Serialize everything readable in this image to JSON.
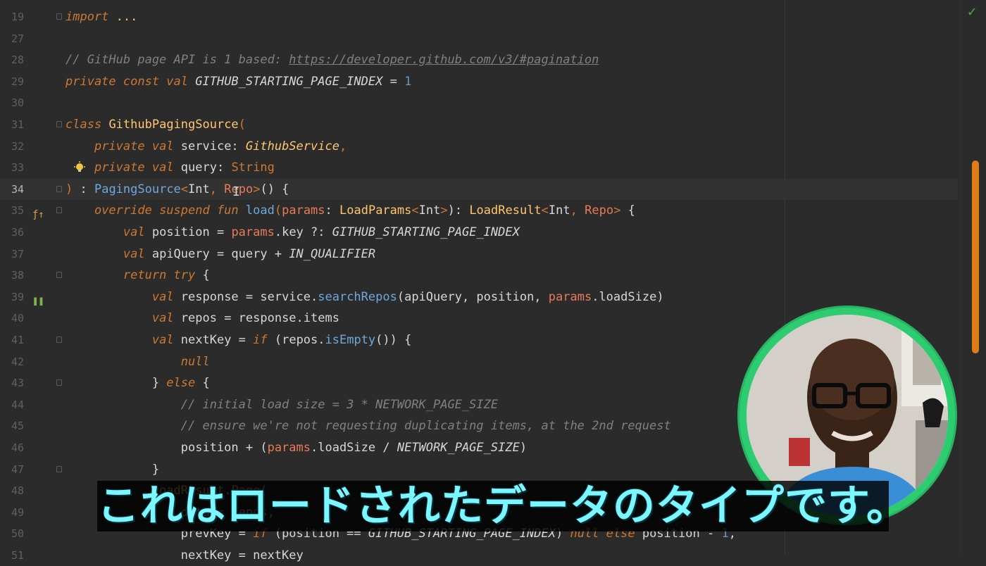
{
  "editor": {
    "lines": [
      {
        "n": "19",
        "segs": [
          {
            "c": "kw",
            "t": "import"
          },
          {
            "c": "plain",
            "t": " "
          },
          {
            "c": "cls",
            "t": "..."
          }
        ],
        "fold": true
      },
      {
        "n": "27",
        "segs": []
      },
      {
        "n": "28",
        "segs": [
          {
            "c": "cmt",
            "t": "// GitHub page API is 1 based: "
          },
          {
            "c": "link",
            "t": "https://developer.github.com/v3/#pagination"
          }
        ]
      },
      {
        "n": "29",
        "segs": [
          {
            "c": "kw",
            "t": "private const val"
          },
          {
            "c": "plain",
            "t": " "
          },
          {
            "c": "cnst",
            "t": "GITHUB_STARTING_PAGE_INDEX"
          },
          {
            "c": "plain",
            "t": " = "
          },
          {
            "c": "num",
            "t": "1"
          }
        ]
      },
      {
        "n": "30",
        "segs": []
      },
      {
        "n": "31",
        "segs": [
          {
            "c": "kw",
            "t": "class"
          },
          {
            "c": "plain",
            "t": " "
          },
          {
            "c": "cls",
            "t": "GithubPagingSource"
          },
          {
            "c": "type",
            "t": "("
          }
        ],
        "fold": true
      },
      {
        "n": "32",
        "segs": [
          {
            "c": "plain",
            "t": "    "
          },
          {
            "c": "kw",
            "t": "private val"
          },
          {
            "c": "plain",
            "t": " service: "
          },
          {
            "c": "cls ital",
            "t": "GithubService"
          },
          {
            "c": "type",
            "t": ","
          }
        ]
      },
      {
        "n": "33",
        "segs": [
          {
            "c": "plain",
            "t": "    "
          },
          {
            "c": "kw",
            "t": "private val"
          },
          {
            "c": "plain",
            "t": " query: "
          },
          {
            "c": "type",
            "t": "String"
          }
        ],
        "bulb": true
      },
      {
        "n": "34",
        "segs": [
          {
            "c": "type",
            "t": ")"
          },
          {
            "c": "plain",
            "t": " : "
          },
          {
            "c": "fn",
            "t": "PagingSource"
          },
          {
            "c": "type",
            "t": "<"
          },
          {
            "c": "plain",
            "t": "Int"
          },
          {
            "c": "type",
            "t": ", "
          },
          {
            "c": "prm",
            "t": "Repo"
          },
          {
            "c": "type",
            "t": ">"
          },
          {
            "c": "plain",
            "t": "() {"
          }
        ],
        "current": true,
        "fold": true
      },
      {
        "n": "35",
        "segs": [
          {
            "c": "plain",
            "t": "    "
          },
          {
            "c": "kw",
            "t": "override suspend fun"
          },
          {
            "c": "plain",
            "t": " "
          },
          {
            "c": "fn",
            "t": "load"
          },
          {
            "c": "type",
            "t": "("
          },
          {
            "c": "prm",
            "t": "params"
          },
          {
            "c": "plain",
            "t": ": "
          },
          {
            "c": "cls",
            "t": "LoadParams"
          },
          {
            "c": "type",
            "t": "<"
          },
          {
            "c": "plain",
            "t": "Int"
          },
          {
            "c": "type",
            "t": ">"
          },
          {
            "c": "plain",
            "t": "): "
          },
          {
            "c": "cls",
            "t": "LoadResult"
          },
          {
            "c": "type",
            "t": "<"
          },
          {
            "c": "plain",
            "t": "Int"
          },
          {
            "c": "type",
            "t": ", "
          },
          {
            "c": "prm",
            "t": "Repo"
          },
          {
            "c": "type",
            "t": ">"
          },
          {
            "c": "plain",
            "t": " {"
          }
        ],
        "fold": true,
        "override": true
      },
      {
        "n": "36",
        "segs": [
          {
            "c": "plain",
            "t": "        "
          },
          {
            "c": "kw",
            "t": "val"
          },
          {
            "c": "plain",
            "t": " position = "
          },
          {
            "c": "prm",
            "t": "params"
          },
          {
            "c": "plain",
            "t": ".key ?: "
          },
          {
            "c": "cnst",
            "t": "GITHUB_STARTING_PAGE_INDEX"
          }
        ]
      },
      {
        "n": "37",
        "segs": [
          {
            "c": "plain",
            "t": "        "
          },
          {
            "c": "kw",
            "t": "val"
          },
          {
            "c": "plain",
            "t": " apiQuery = query + "
          },
          {
            "c": "cnst",
            "t": "IN_QUALIFIER"
          }
        ]
      },
      {
        "n": "38",
        "segs": [
          {
            "c": "plain",
            "t": "        "
          },
          {
            "c": "kw",
            "t": "return try"
          },
          {
            "c": "plain",
            "t": " {"
          }
        ],
        "fold": true
      },
      {
        "n": "39",
        "segs": [
          {
            "c": "plain",
            "t": "            "
          },
          {
            "c": "kw",
            "t": "val"
          },
          {
            "c": "plain",
            "t": " response = service."
          },
          {
            "c": "fn",
            "t": "searchRepos"
          },
          {
            "c": "plain",
            "t": "(apiQuery, position, "
          },
          {
            "c": "prm",
            "t": "params"
          },
          {
            "c": "plain",
            "t": ".loadSize)"
          }
        ],
        "pause": true
      },
      {
        "n": "40",
        "segs": [
          {
            "c": "plain",
            "t": "            "
          },
          {
            "c": "kw",
            "t": "val"
          },
          {
            "c": "plain",
            "t": " repos = response.items"
          }
        ]
      },
      {
        "n": "41",
        "segs": [
          {
            "c": "plain",
            "t": "            "
          },
          {
            "c": "kw",
            "t": "val"
          },
          {
            "c": "plain",
            "t": " nextKey = "
          },
          {
            "c": "kw",
            "t": "if"
          },
          {
            "c": "plain",
            "t": " (repos."
          },
          {
            "c": "fn",
            "t": "isEmpty"
          },
          {
            "c": "plain",
            "t": "()) {"
          }
        ],
        "fold": true
      },
      {
        "n": "42",
        "segs": [
          {
            "c": "plain",
            "t": "                "
          },
          {
            "c": "kw",
            "t": "null"
          }
        ]
      },
      {
        "n": "43",
        "segs": [
          {
            "c": "plain",
            "t": "            } "
          },
          {
            "c": "kw",
            "t": "else"
          },
          {
            "c": "plain",
            "t": " {"
          }
        ],
        "fold": true
      },
      {
        "n": "44",
        "segs": [
          {
            "c": "plain",
            "t": "                "
          },
          {
            "c": "cmt",
            "t": "// initial load size = 3 * NETWORK_PAGE_SIZE"
          }
        ]
      },
      {
        "n": "45",
        "segs": [
          {
            "c": "plain",
            "t": "                "
          },
          {
            "c": "cmt",
            "t": "// ensure we're not requesting duplicating items, at the 2nd request"
          }
        ]
      },
      {
        "n": "46",
        "segs": [
          {
            "c": "plain",
            "t": "                position + ("
          },
          {
            "c": "prm",
            "t": "params"
          },
          {
            "c": "plain",
            "t": ".loadSize / "
          },
          {
            "c": "cnst",
            "t": "NETWORK_PAGE_SIZE"
          },
          {
            "c": "plain",
            "t": ")"
          }
        ]
      },
      {
        "n": "47",
        "segs": [
          {
            "c": "plain",
            "t": "            }"
          }
        ],
        "fold": true
      },
      {
        "n": "48",
        "segs": [
          {
            "c": "plain",
            "t": "            "
          },
          {
            "c": "cls",
            "t": "LoadResult"
          },
          {
            "c": "plain",
            "t": "."
          },
          {
            "c": "cls",
            "t": "Page"
          },
          {
            "c": "plain",
            "t": "("
          }
        ]
      },
      {
        "n": "49",
        "segs": [
          {
            "c": "plain",
            "t": "                data = repos,"
          }
        ]
      },
      {
        "n": "50",
        "segs": [
          {
            "c": "plain",
            "t": "                prevKey = "
          },
          {
            "c": "kw",
            "t": "if"
          },
          {
            "c": "plain",
            "t": " (position == "
          },
          {
            "c": "cnst",
            "t": "GITHUB_STARTING_PAGE_INDEX"
          },
          {
            "c": "plain",
            "t": ") "
          },
          {
            "c": "kw",
            "t": "null else"
          },
          {
            "c": "plain",
            "t": " position - "
          },
          {
            "c": "num",
            "t": "1"
          },
          {
            "c": "plain",
            "t": ","
          }
        ]
      },
      {
        "n": "51",
        "segs": [
          {
            "c": "plain",
            "t": "                nextKey = nextKey"
          }
        ]
      }
    ]
  },
  "icons": {
    "status": "checkmark-icon",
    "bulb": "lightbulb-icon",
    "override": "override-function-icon",
    "pause": "pause-breakpoint-icon"
  },
  "colors": {
    "background": "#2b2b2b",
    "accent_scroll": "#e07b1a",
    "avatar_ring": "#2ecc71",
    "subtitle_text": "#7cf7ff"
  },
  "subtitle": {
    "text": "これはロードされたデータのタイプです。"
  },
  "status": {
    "check_glyph": "✓"
  }
}
